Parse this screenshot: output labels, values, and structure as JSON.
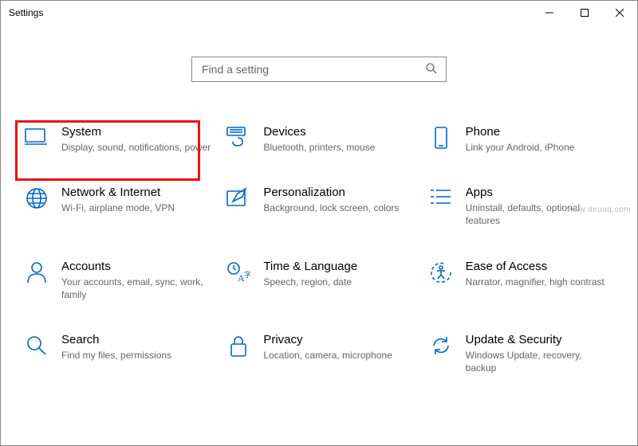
{
  "window": {
    "title": "Settings"
  },
  "search": {
    "placeholder": "Find a setting"
  },
  "tiles": {
    "system": {
      "title": "System",
      "desc": "Display, sound, notifications, power"
    },
    "devices": {
      "title": "Devices",
      "desc": "Bluetooth, printers, mouse"
    },
    "phone": {
      "title": "Phone",
      "desc": "Link your Android, iPhone"
    },
    "network": {
      "title": "Network & Internet",
      "desc": "Wi-Fi, airplane mode, VPN"
    },
    "personalization": {
      "title": "Personalization",
      "desc": "Background, lock screen, colors"
    },
    "apps": {
      "title": "Apps",
      "desc": "Uninstall, defaults, optional features"
    },
    "accounts": {
      "title": "Accounts",
      "desc": "Your accounts, email, sync, work, family"
    },
    "time": {
      "title": "Time & Language",
      "desc": "Speech, region, date"
    },
    "ease": {
      "title": "Ease of Access",
      "desc": "Narrator, magnifier, high contrast"
    },
    "search_tile": {
      "title": "Search",
      "desc": "Find my files, permissions"
    },
    "privacy": {
      "title": "Privacy",
      "desc": "Location, camera, microphone"
    },
    "update": {
      "title": "Update & Security",
      "desc": "Windows Update, recovery, backup"
    }
  },
  "highlighted_tile": "system",
  "watermark": "www.deuaq.com",
  "accent_color": "#0066cc"
}
